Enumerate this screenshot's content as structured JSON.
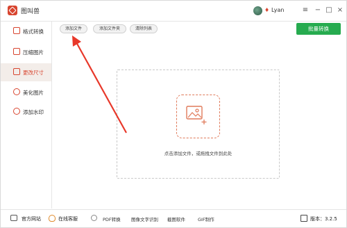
{
  "app": {
    "title": "图叫兽",
    "username": "Lyan"
  },
  "window_controls": {
    "menu": "≡",
    "minimize": "−",
    "maximize": "□",
    "close": "×"
  },
  "sidebar": {
    "items": [
      {
        "label": "格式转换",
        "icon": "format-convert-icon",
        "active": false
      },
      {
        "label": "压缩图片",
        "icon": "compress-image-icon",
        "active": false
      },
      {
        "label": "更改尺寸",
        "icon": "resize-icon",
        "active": true
      },
      {
        "label": "美化图片",
        "icon": "beautify-icon",
        "active": false
      },
      {
        "label": "添加水印",
        "icon": "watermark-icon",
        "active": false
      }
    ]
  },
  "toolbar": {
    "add_file": "添加文件",
    "add_folder": "添加文件夹",
    "clear_list": "清除列表",
    "batch_convert": "批量转换"
  },
  "dropzone": {
    "hint": "点击添加文件，或拖拽文件到此处",
    "icon": "image-add-icon"
  },
  "footer": {
    "website": "官方网站",
    "support": "在线客服",
    "pdf": "PDF转换",
    "ocr": "图像文字识别",
    "screen": "截图软件",
    "gif": "GIF制作",
    "version": "版本：3.2.5"
  },
  "colors": {
    "accent": "#d8452f",
    "batch_button": "#26ab4f",
    "active_nav_bg": "#f3ede9",
    "annotation_arrow": "#e8382a"
  }
}
